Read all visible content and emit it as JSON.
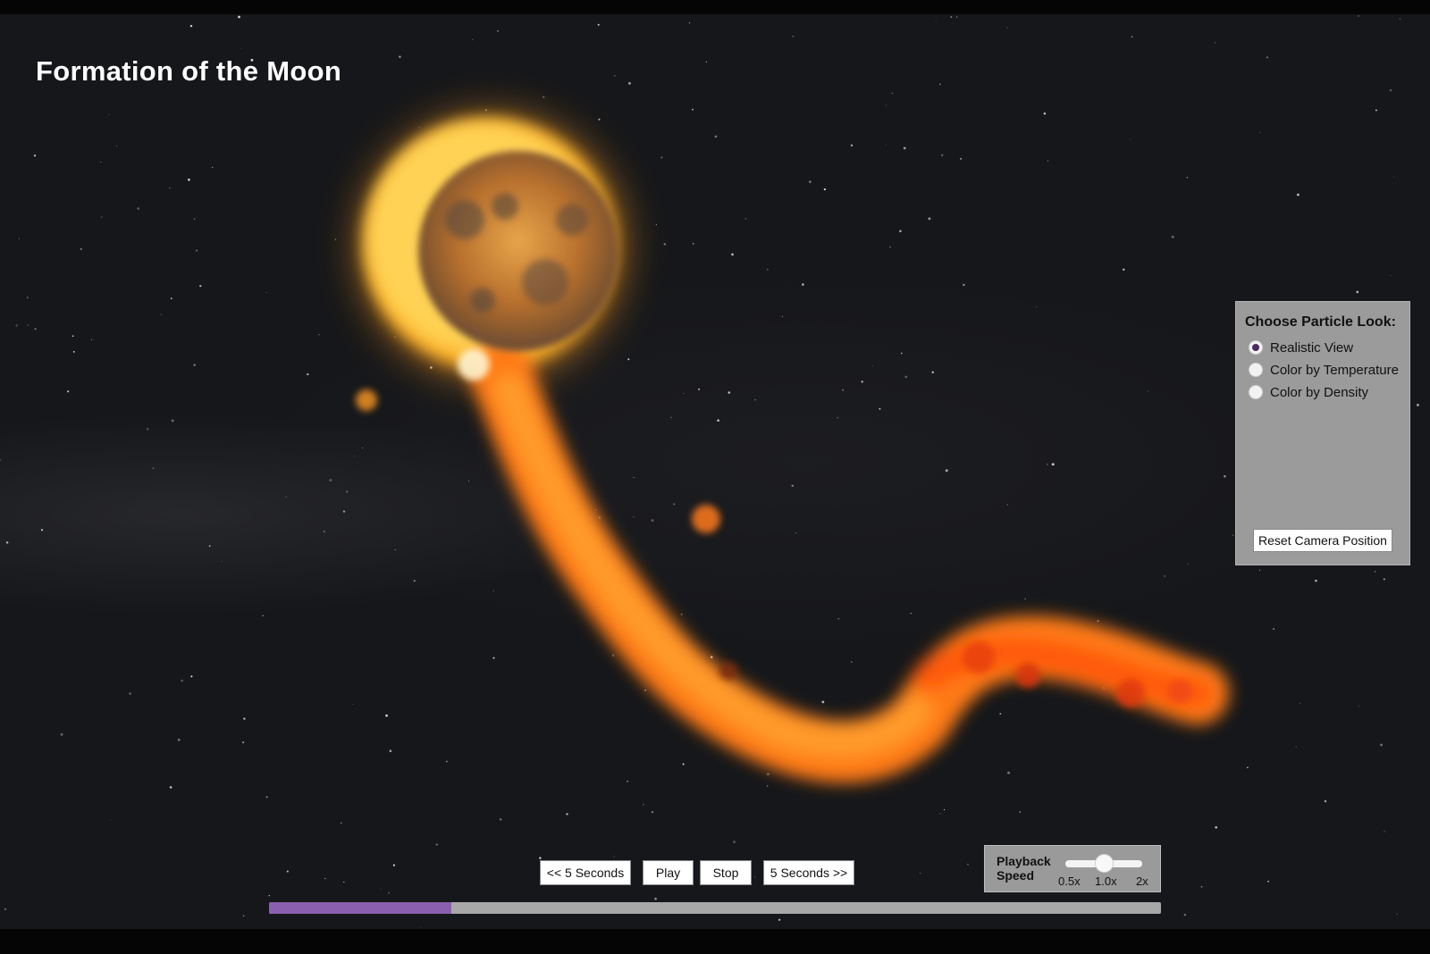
{
  "app": {
    "title": "Formation of the Moon"
  },
  "particle_panel": {
    "heading": "Choose Particle Look:",
    "options": [
      {
        "label": "Realistic View",
        "selected": true
      },
      {
        "label": "Color by Temperature",
        "selected": false
      },
      {
        "label": "Color by Density",
        "selected": false
      }
    ],
    "reset_label": "Reset Camera Position"
  },
  "controls": {
    "back_label": "<< 5 Seconds",
    "play_label": "Play",
    "stop_label": "Stop",
    "forward_label": "5 Seconds >>"
  },
  "playback_speed": {
    "label": "Playback Speed",
    "ticks": [
      "0.5x",
      "1.0x",
      "2x"
    ],
    "current": "1.0x",
    "slider_fraction": 0.5
  },
  "timeline": {
    "progress_fraction": 0.204
  },
  "colors": {
    "accent": "#8a5fb0",
    "panel_bg": "#9b9b9b",
    "radio_checked": "#4a2a63"
  }
}
